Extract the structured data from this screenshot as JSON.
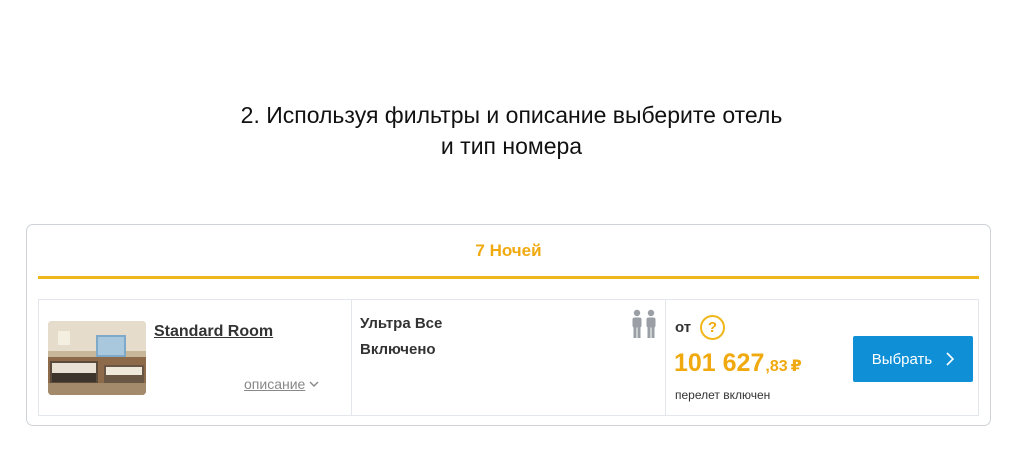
{
  "instruction": {
    "line1": "2. Используя фильтры и описание выберите отель",
    "line2": "и тип номера"
  },
  "tab": {
    "nights_label": "7 Ночей"
  },
  "room": {
    "name": "Standard Room",
    "description_link": "описание",
    "photo_icon": "hotel-room-photo"
  },
  "meal": {
    "line1": "Ультра Все",
    "line2": "Включено",
    "guests_icon": "two-guests-icon"
  },
  "price": {
    "from_label": "от",
    "help_label": "?",
    "amount_int": "101 627",
    "amount_frac": ",83",
    "currency": "₽",
    "note": "перелет включен"
  },
  "actions": {
    "select_label": "Выбрать"
  },
  "colors": {
    "accent": "#f0a90f",
    "button": "#0f90d6",
    "border": "#cfd3d8"
  }
}
